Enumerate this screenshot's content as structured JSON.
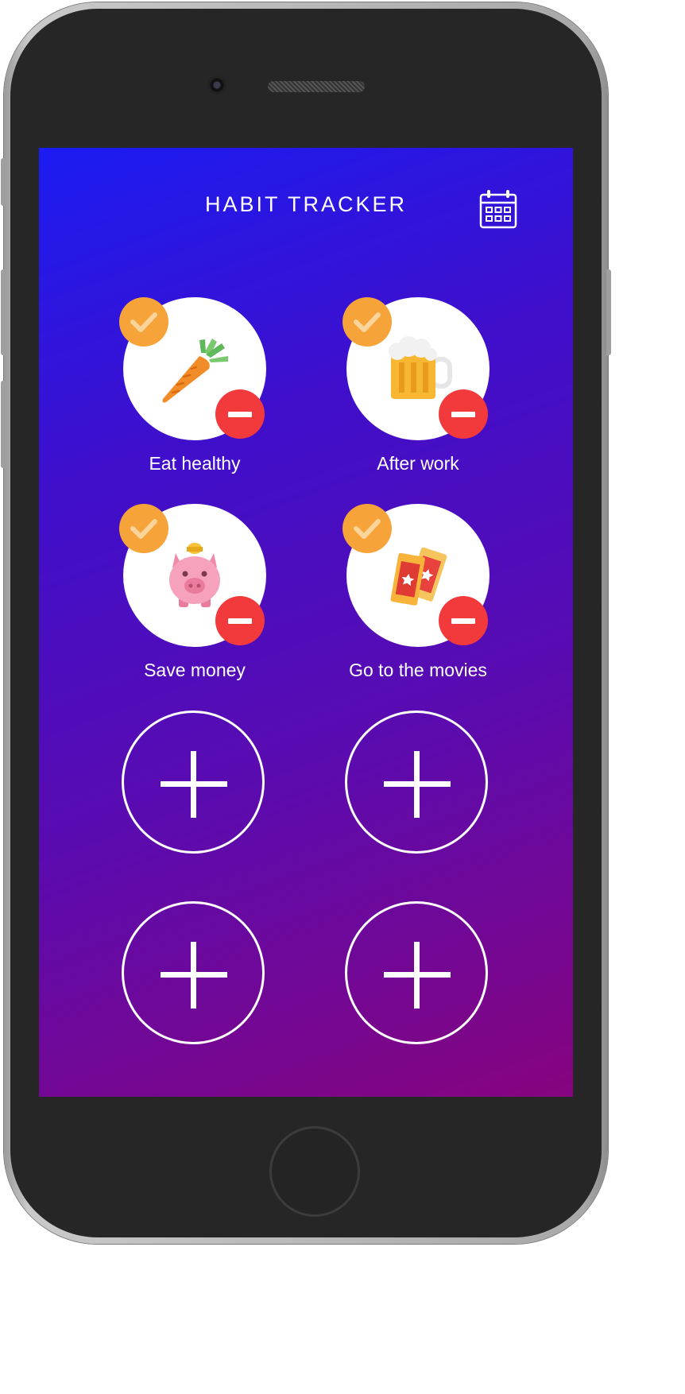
{
  "app": {
    "title": "HABIT TRACKER"
  },
  "header": {
    "calendar_icon": "calendar-icon"
  },
  "habits": [
    {
      "label": "Eat healthy",
      "icon": "carrot-icon",
      "checked": true
    },
    {
      "label": "After work",
      "icon": "beer-mug-icon",
      "checked": true
    },
    {
      "label": "Save money",
      "icon": "piggy-bank-icon",
      "checked": true
    },
    {
      "label": "Go to the movies",
      "icon": "movie-tickets-icon",
      "checked": true
    }
  ],
  "empty_slots": 4,
  "colors": {
    "gradient_start": "#1b1cf2",
    "gradient_end": "#86047e",
    "check_badge": "#f6a33a",
    "remove_badge": "#f23a3c",
    "text": "#ffffff"
  }
}
